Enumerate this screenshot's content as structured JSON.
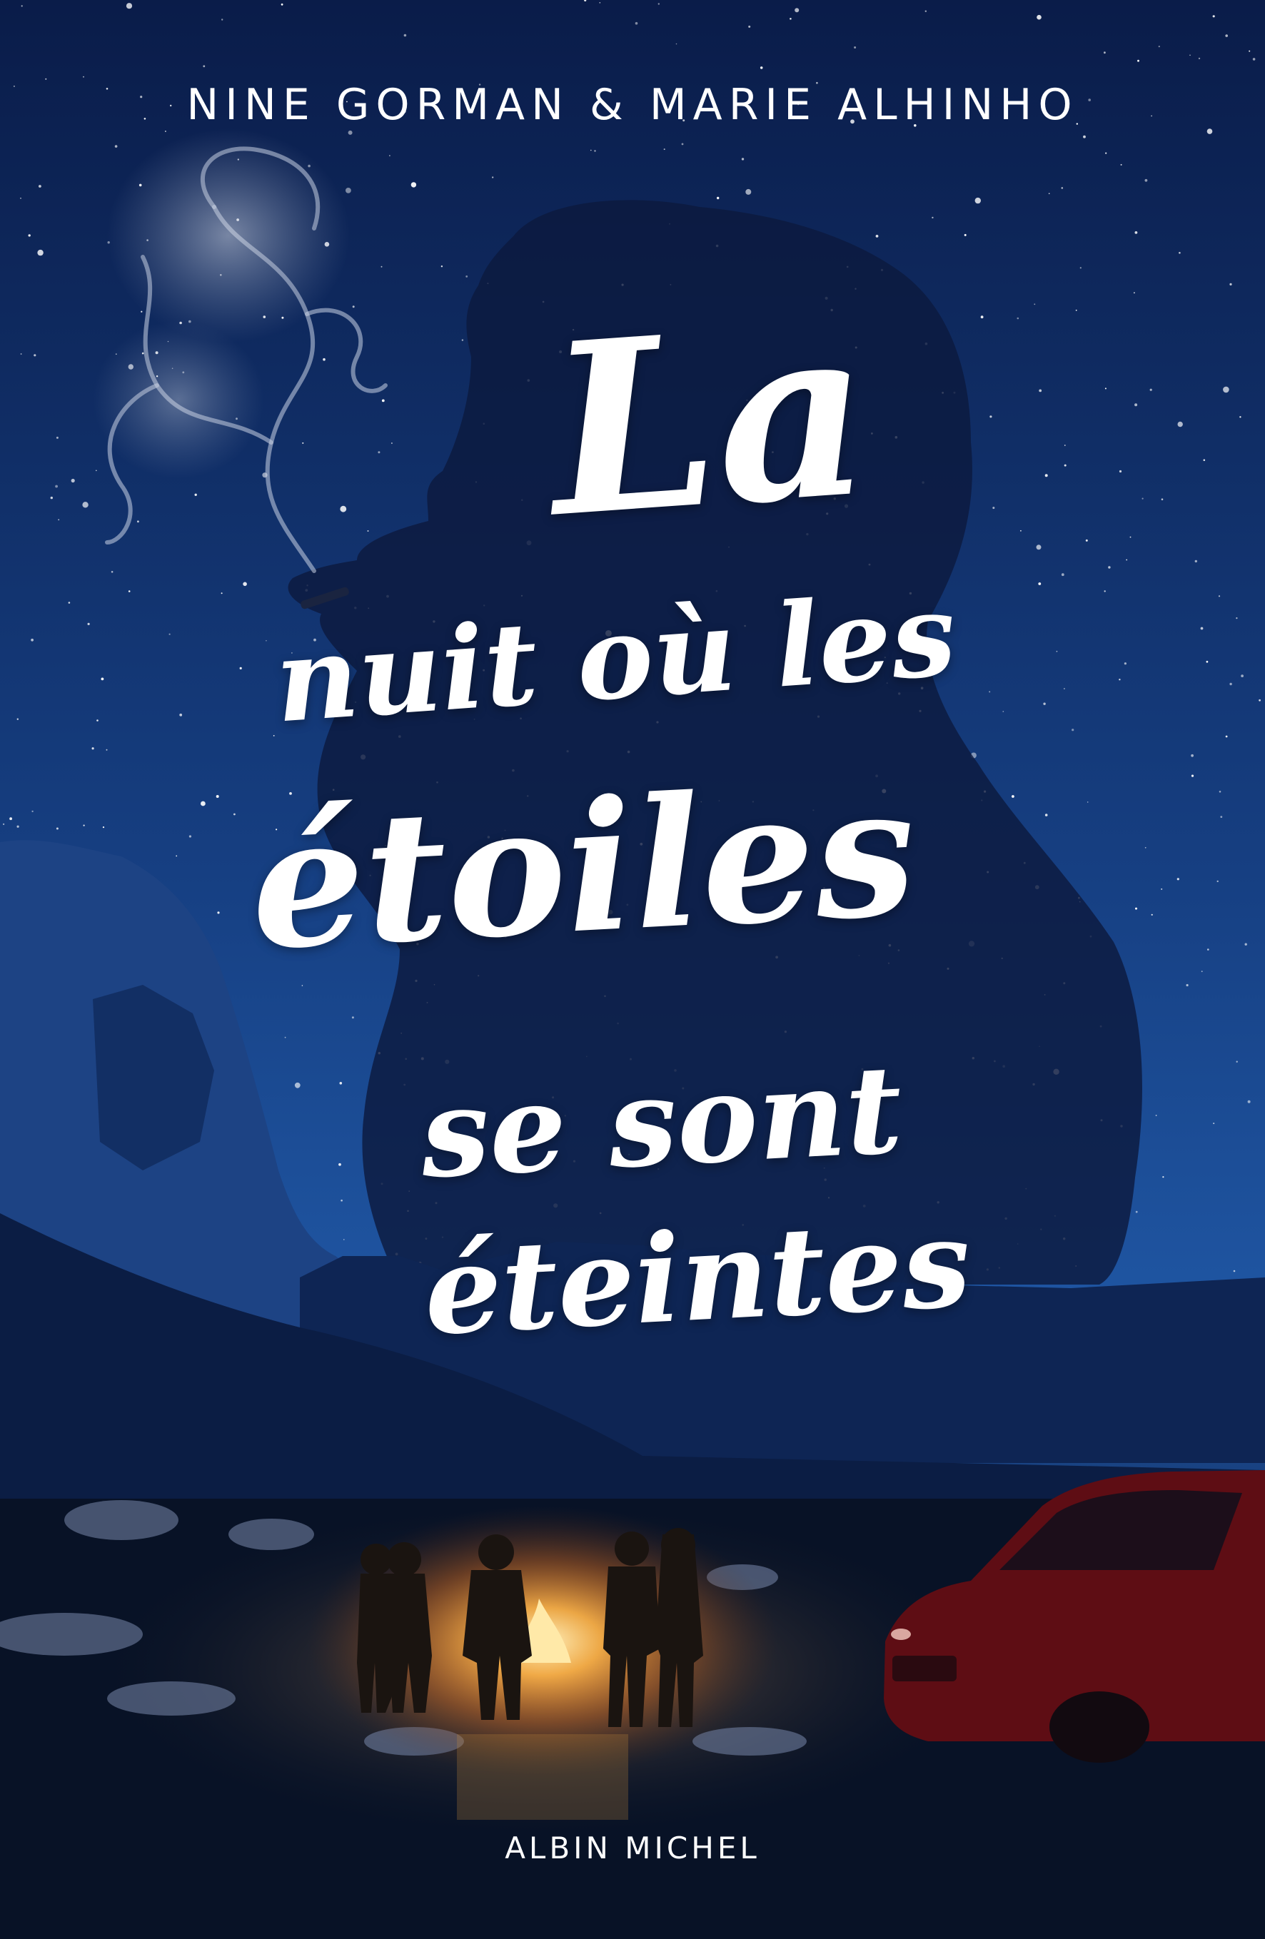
{
  "cover": {
    "authors": "NINE GORMAN & MARIE ALHINHO",
    "title_lines": [
      "La",
      "nuit où les",
      "étoiles",
      "se sont",
      "éteintes"
    ],
    "publisher": "ALBIN MICHEL"
  },
  "colors": {
    "sky_top": "#0b1f4f",
    "sky_mid": "#1e4f96",
    "silhouette": "#0c1838",
    "mountain": "#1b3f7a",
    "campfire": "#ffb347",
    "car": "#6b0f16",
    "text": "#ffffff"
  },
  "illustration": {
    "elements": [
      "starry-night-sky",
      "smoke-wisps",
      "smoking-man-silhouette",
      "desert-rock-formations",
      "campfire",
      "group-of-five-people",
      "red-suv"
    ]
  }
}
